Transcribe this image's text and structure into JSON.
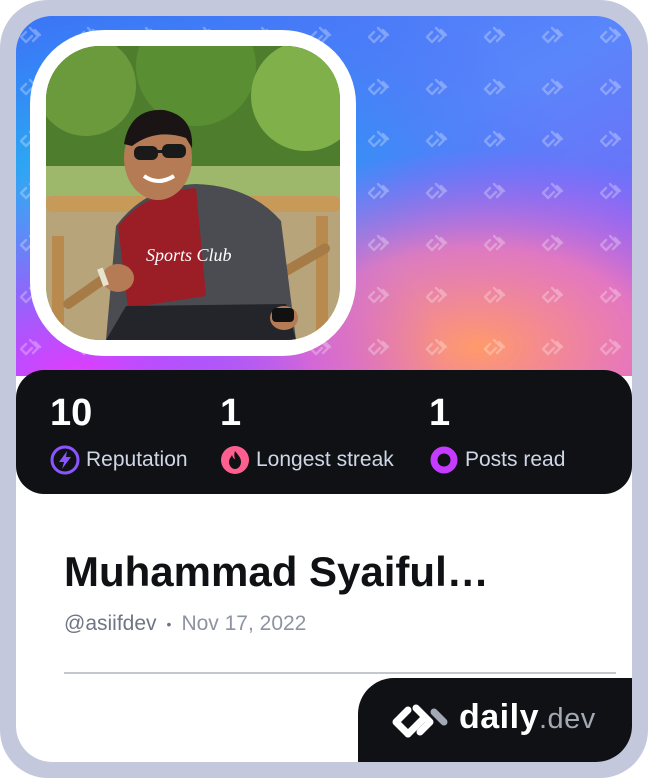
{
  "stats": [
    {
      "value": "10",
      "label": "Reputation",
      "icon": "lightning-icon",
      "color": "#8a55ff"
    },
    {
      "value": "1",
      "label": "Longest streak",
      "icon": "flame-icon",
      "color": "#ff5f8f"
    },
    {
      "value": "1",
      "label": "Posts read",
      "icon": "ring-icon",
      "color": "#c53bff"
    }
  ],
  "profile": {
    "name": "Muhammad Syaiful…",
    "username": "@asiifdev",
    "separator": "•",
    "joined": "Nov 17, 2022"
  },
  "brand": {
    "name": "daily",
    "suffix": ".dev",
    "logo_icon": "daily-dev-logo-icon"
  },
  "avatar": {
    "photo_subject": "profile-photo",
    "shirt_text": "Sports Club"
  },
  "colors": {
    "frame": "#c3c8dd",
    "dark": "#0f1115",
    "cover_gradient_1": "#1ec2f1",
    "cover_gradient_2": "#5b7cf7",
    "cover_gradient_3": "#cf4cff",
    "cover_gradient_4": "#ff8f6f"
  }
}
